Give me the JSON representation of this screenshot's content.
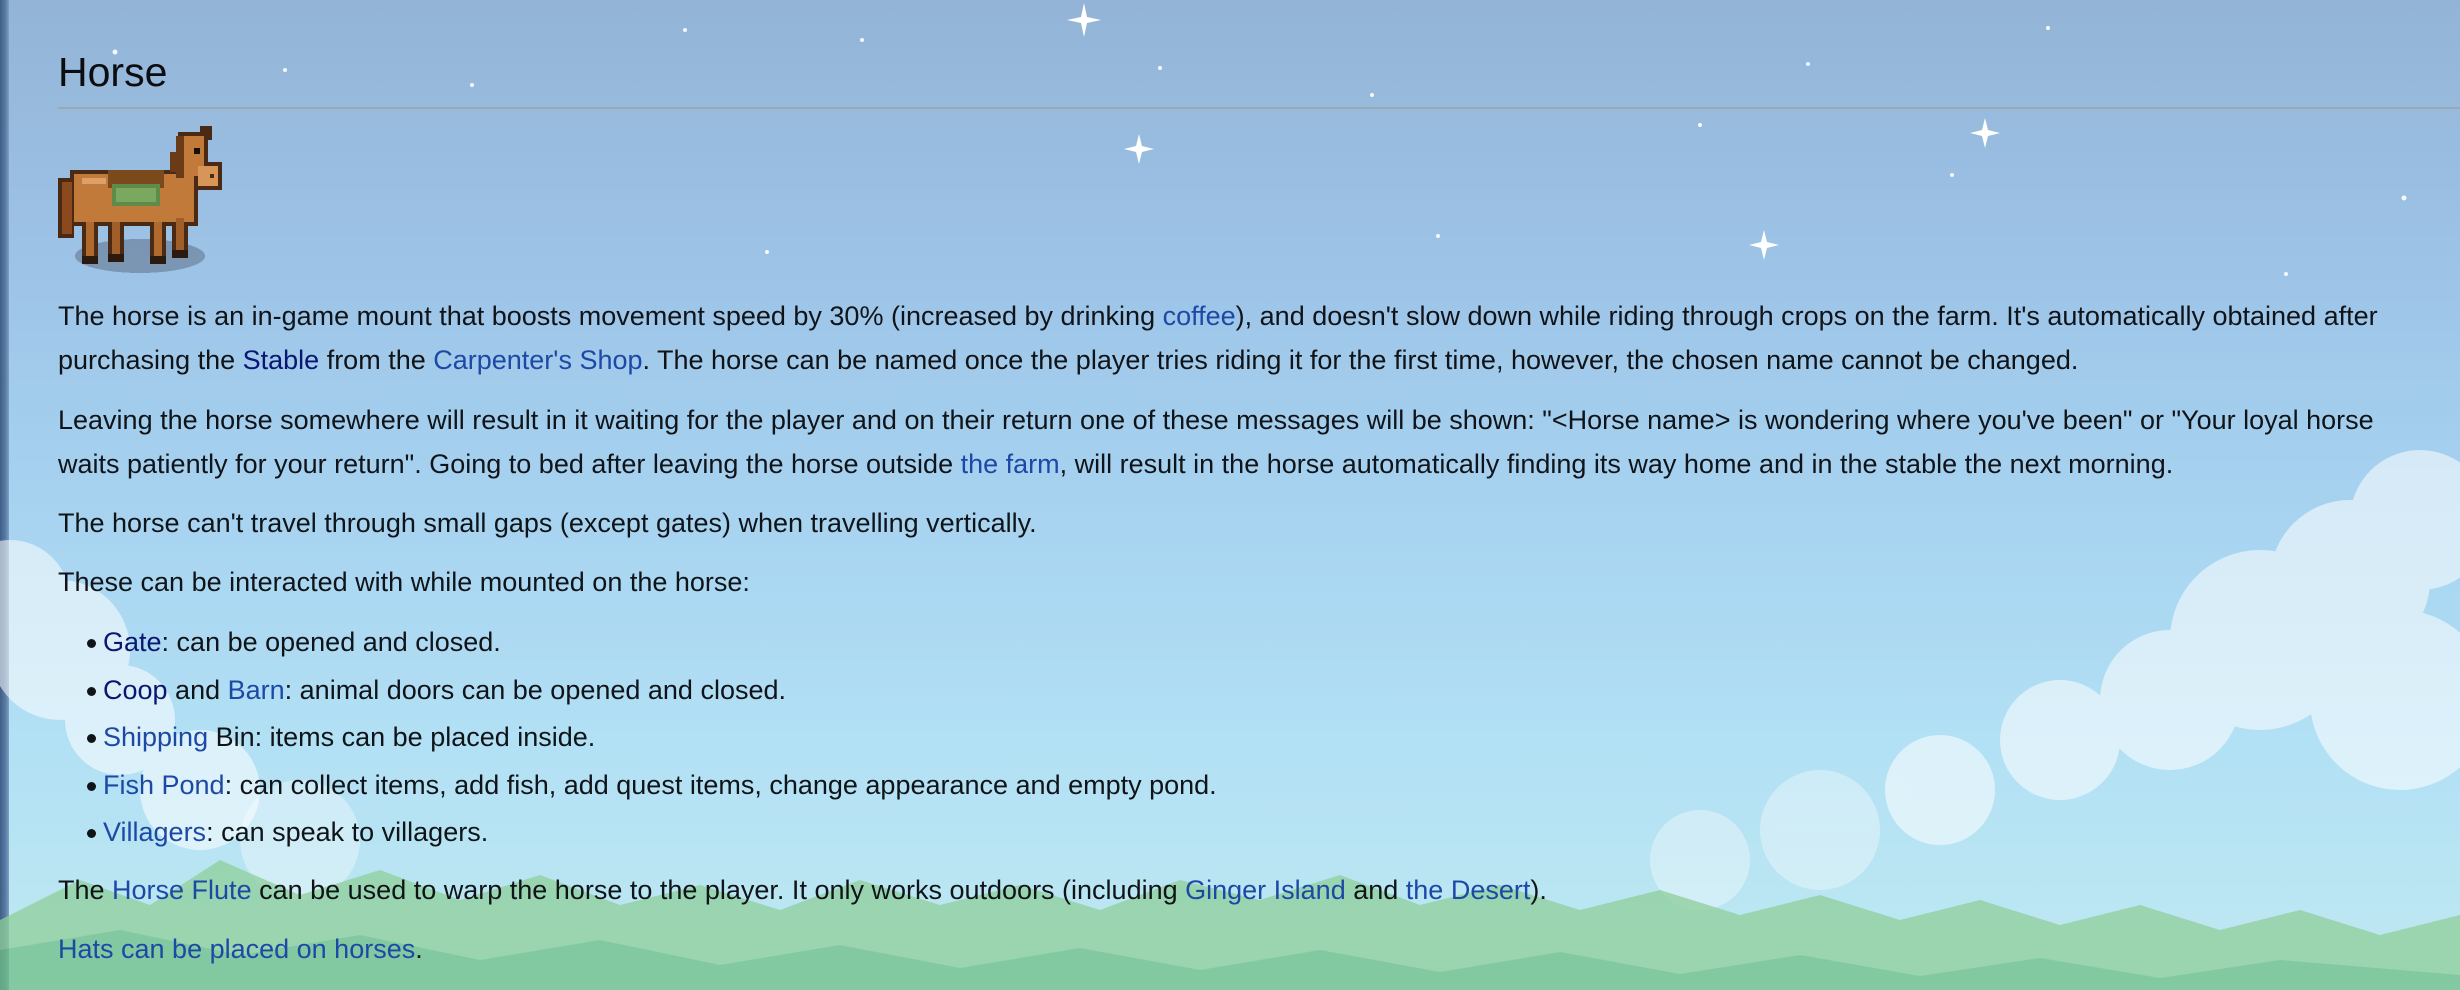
{
  "page": {
    "title": "Horse"
  },
  "p1": {
    "t1": "The horse is an in-game mount that boosts movement speed by 30% (increased by drinking ",
    "coffee": "coffee",
    "t2": "), and doesn't slow down while riding through crops on the farm. It's automatically obtained after purchasing the ",
    "stable": "Stable",
    "t3": " from the ",
    "carpenter": "Carpenter's Shop",
    "t4": ". The horse can be named once the player tries riding it for the first time, however, the chosen name cannot be changed."
  },
  "p2": {
    "t1": "Leaving the horse somewhere will result in it waiting for the player and on their return one of these messages will be shown: \"<Horse name> is wondering where you've been\" or \"Your loyal horse waits patiently for your return\". Going to bed after leaving the horse outside ",
    "farm": "the farm",
    "t2": ", will result in the horse automatically finding its way home and in the stable the next morning."
  },
  "p3": {
    "text": "The horse can't travel through small gaps (except gates) when travelling vertically."
  },
  "p4": {
    "text": "These can be interacted with while mounted on the horse:"
  },
  "list": {
    "gate": {
      "link": "Gate",
      "text": ": can be opened and closed."
    },
    "coop_barn": {
      "coop": "Coop",
      "and": " and ",
      "barn": "Barn",
      "text": ": animal doors can be opened and closed."
    },
    "shipping": {
      "link": "Shipping",
      "text": " Bin: items can be placed inside."
    },
    "fishpond": {
      "link": "Fish Pond",
      "text": ": can collect items, add fish, add quest items, change appearance and empty pond."
    },
    "villagers": {
      "link": "Villagers",
      "text": ": can speak to villagers."
    }
  },
  "p5": {
    "t1": "The ",
    "flute": "Horse Flute",
    "t2": " can be used to warp the horse to the player. It only works outdoors (including ",
    "ginger": "Ginger Island",
    "t3": " and ",
    "desert": "the Desert",
    "t4": ")."
  },
  "p6": {
    "hats": "Hats can be placed on horses",
    "end": "."
  },
  "colors": {
    "link": "#1d49a6",
    "link_visited": "#0a1670",
    "text": "#101418",
    "sky_top": "#93b4d6",
    "sky_bottom": "#bfe9f2"
  },
  "icons": {
    "horse": "horse-sprite-icon"
  }
}
